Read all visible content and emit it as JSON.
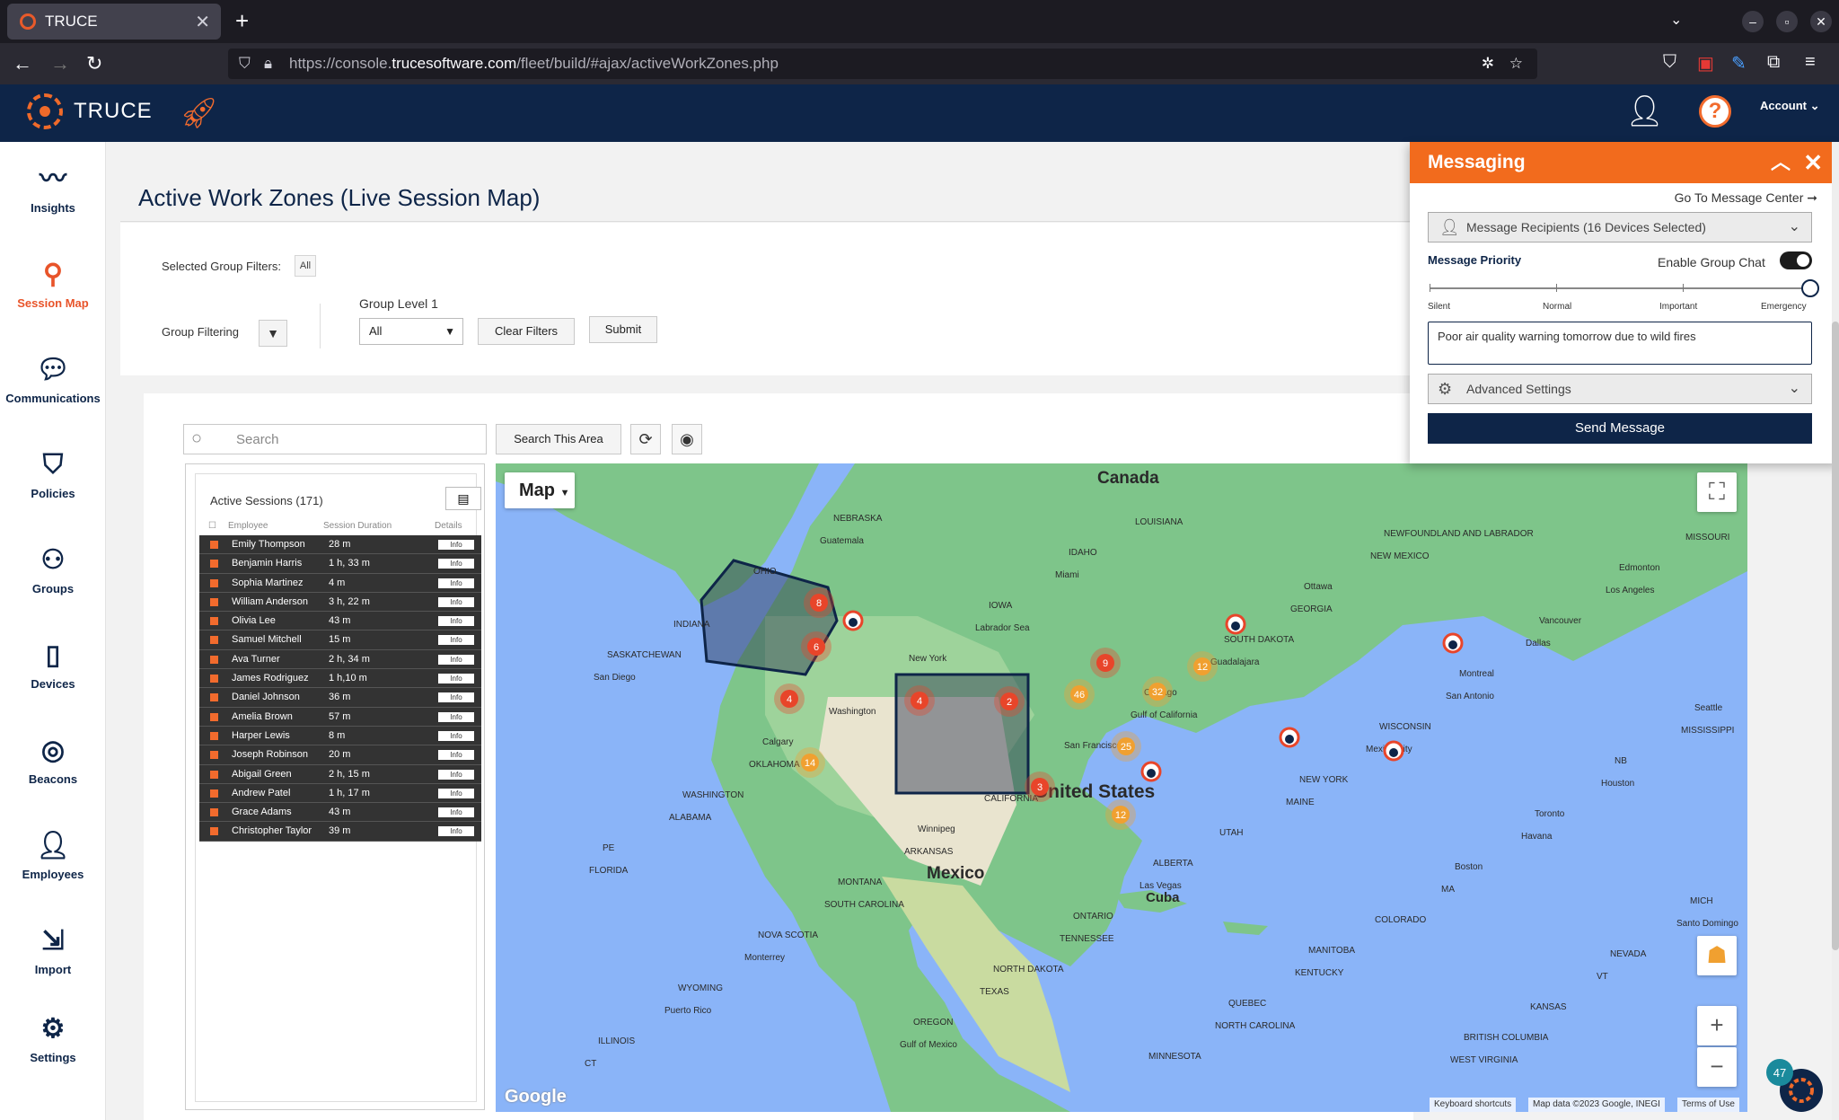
{
  "browser": {
    "tab_title": "TRUCE",
    "url_prefix": "https://console.",
    "url_domain": "trucesoftware.com",
    "url_path": "/fleet/build/#ajax/activeWorkZones.php"
  },
  "header": {
    "brand": "TRUCE",
    "account_label": "Account ⌄"
  },
  "sidebar": {
    "items": [
      {
        "label": "Insights",
        "icon": "insights-icon"
      },
      {
        "label": "Session Map",
        "icon": "map-pin-icon"
      },
      {
        "label": "Communications",
        "icon": "chat-icon"
      },
      {
        "label": "Policies",
        "icon": "shield-icon"
      },
      {
        "label": "Groups",
        "icon": "groups-icon"
      },
      {
        "label": "Devices",
        "icon": "device-icon"
      },
      {
        "label": "Beacons",
        "icon": "beacon-icon"
      },
      {
        "label": "Employees",
        "icon": "employee-icon"
      },
      {
        "label": "Import",
        "icon": "import-icon"
      },
      {
        "label": "Settings",
        "icon": "gear-icon"
      }
    ]
  },
  "page": {
    "title": "Active Work Zones (Live Session Map)"
  },
  "filters": {
    "selected_label": "Selected Group Filters:",
    "selected_value": "All",
    "group_filtering_label": "Group Filtering",
    "group_level_label": "Group Level 1",
    "group_level_value": "All",
    "clear_label": "Clear Filters",
    "submit_label": "Submit"
  },
  "map_toolbar": {
    "search_placeholder": "Search",
    "search_area_label": "Search This Area"
  },
  "sessions": {
    "title": "Active Sessions (171)",
    "columns": [
      "Employee",
      "Session Duration",
      "Details"
    ],
    "info_label": "Info",
    "rows": [
      {
        "name": "Emily Thompson",
        "duration": "28 m"
      },
      {
        "name": "Benjamin Harris",
        "duration": "1 h, 33 m"
      },
      {
        "name": "Sophia Martinez",
        "duration": "4 m"
      },
      {
        "name": "William Anderson",
        "duration": "3 h, 22 m"
      },
      {
        "name": "Olivia Lee",
        "duration": "43 m"
      },
      {
        "name": "Samuel Mitchell",
        "duration": "15 m"
      },
      {
        "name": "Ava Turner",
        "duration": "2 h, 34 m"
      },
      {
        "name": "James Rodriguez",
        "duration": "1 h,10 m"
      },
      {
        "name": "Daniel Johnson",
        "duration": "36 m"
      },
      {
        "name": "Amelia Brown",
        "duration": "57 m"
      },
      {
        "name": "Harper Lewis",
        "duration": "8 m"
      },
      {
        "name": "Joseph Robinson",
        "duration": "20 m"
      },
      {
        "name": "Abigail Green",
        "duration": "2 h, 15 m"
      },
      {
        "name": "Andrew Patel",
        "duration": "1 h, 17 m"
      },
      {
        "name": "Grace Adams",
        "duration": "43 m"
      },
      {
        "name": "Christopher Taylor",
        "duration": "39 m"
      }
    ]
  },
  "map": {
    "type_button": "Map",
    "country_labels": [
      "Canada",
      "United States",
      "Mexico",
      "Cuba"
    ],
    "place_labels": [
      "ALBERTA",
      "MANITOBA",
      "BRITISH COLUMBIA",
      "Edmonton",
      "SASKATCHEWAN",
      "Calgary",
      "Winnipeg",
      "ONTARIO",
      "QUEBEC",
      "NEWFOUNDLAND AND LABRADOR",
      "Vancouver",
      "Seattle",
      "WASHINGTON",
      "MONTANA",
      "NORTH DAKOTA",
      "MINNESOTA",
      "Ottawa",
      "Montreal",
      "NB",
      "PE",
      "NOVA SCOTIA",
      "OREGON",
      "IDAHO",
      "SOUTH DAKOTA",
      "WISCONSIN",
      "Toronto",
      "MICH",
      "WYOMING",
      "NEBRASKA",
      "IOWA",
      "Chicago",
      "NEW YORK",
      "Boston",
      "NEVADA",
      "ILLINOIS",
      "OHIO",
      "New York",
      "San Francisco",
      "UTAH",
      "COLORADO",
      "KANSAS",
      "MISSOURI",
      "INDIANA",
      "Washington",
      "CALIFORNIA",
      "Las Vegas",
      "KENTUCKY",
      "WEST VIRGINIA",
      "Los Angeles",
      "San Diego",
      "OKLAHOMA",
      "ARKANSAS",
      "TENNESSEE",
      "NORTH CAROLINA",
      "NEW MEXICO",
      "Dallas",
      "MISSISSIPPI",
      "ALABAMA",
      "SOUTH CAROLINA",
      "TEXAS",
      "LOUISIANA",
      "GEORGIA",
      "San Antonio",
      "Houston",
      "FLORIDA",
      "Monterrey",
      "Gulf of Mexico",
      "Miami",
      "Guadalajara",
      "Mexico City",
      "Havana",
      "Santo Domingo",
      "Puerto Rico",
      "Guatemala",
      "Labrador Sea",
      "Gulf of California",
      "MAINE",
      "MA",
      "VT",
      "CT"
    ],
    "clusters": [
      {
        "count": "8",
        "color": "#e8452a"
      },
      {
        "count": "6",
        "color": "#e8452a"
      },
      {
        "count": "4",
        "color": "#e8452a"
      },
      {
        "count": "4",
        "color": "#e8452a"
      },
      {
        "count": "2",
        "color": "#e8452a"
      },
      {
        "count": "9",
        "color": "#e8452a"
      },
      {
        "count": "12",
        "color": "#f0a030"
      },
      {
        "count": "46",
        "color": "#f0a030"
      },
      {
        "count": "32",
        "color": "#f0a030"
      },
      {
        "count": "25",
        "color": "#f0a030"
      },
      {
        "count": "14",
        "color": "#f0a030"
      },
      {
        "count": "3",
        "color": "#e8452a"
      },
      {
        "count": "12",
        "color": "#f0a030"
      }
    ],
    "google": "Google",
    "shortcuts": "Keyboard shortcuts",
    "mapdata": "Map data ©2023 Google, INEGI",
    "terms": "Terms of Use",
    "chat_badge": "47"
  },
  "messaging": {
    "title": "Messaging",
    "go_to": "Go To Message Center ➞",
    "recipients": "Message Recipients (16 Devices Selected)",
    "priority_label": "Message Priority",
    "group_chat": "Enable Group Chat",
    "priority_levels": [
      "Silent",
      "Normal",
      "Important",
      "Emergency"
    ],
    "priority_value": "Emergency",
    "message": "Poor air quality warning tomorrow due to wild fires",
    "advanced": "Advanced Settings",
    "send": "Send Message"
  },
  "colors": {
    "navy": "#0e2548",
    "orange": "#f26b1d",
    "water": "#8ab4f8",
    "land": "#7ec58a"
  }
}
